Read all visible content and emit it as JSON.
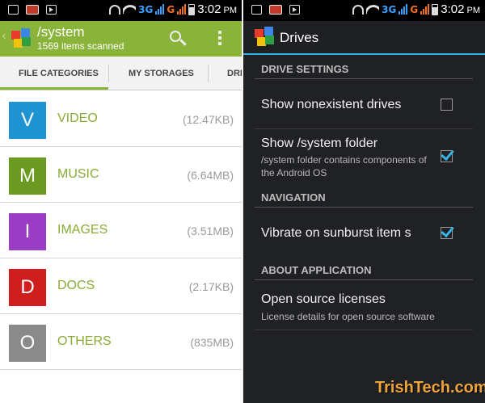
{
  "status_bar": {
    "time": "3:02",
    "period": "PM",
    "network_3g": "3G",
    "network_g": "G"
  },
  "left_screen": {
    "title": "/system",
    "subtitle": "1569 items scanned",
    "accent_color": "#8ab33a",
    "tabs": [
      {
        "label": "FILE CATEGORIES",
        "active": true
      },
      {
        "label": "MY STORAGES",
        "active": false
      },
      {
        "label": "DRI",
        "active": false
      }
    ],
    "categories": [
      {
        "letter": "V",
        "name": "VIDEO",
        "size": "(12.47KB)",
        "color": "#1e94d2"
      },
      {
        "letter": "M",
        "name": "MUSIC",
        "size": "(6.64MB)",
        "color": "#6a9a1f"
      },
      {
        "letter": "I",
        "name": "IMAGES",
        "size": "(3.51MB)",
        "color": "#9b3cc4"
      },
      {
        "letter": "D",
        "name": "DOCS",
        "size": "(2.17KB)",
        "color": "#d01e1e"
      },
      {
        "letter": "O",
        "name": "OTHERS",
        "size": "(835MB)",
        "color": "#8a8a8a"
      }
    ]
  },
  "right_screen": {
    "title": "Drives",
    "accent_color": "#33b5e5",
    "sections": {
      "drive_settings": "DRIVE SETTINGS",
      "navigation": "NAVIGATION",
      "about": "ABOUT APPLICATION"
    },
    "prefs": {
      "nonexistent": {
        "title": "Show nonexistent drives",
        "checked": false
      },
      "system_folder": {
        "title": "Show /system folder",
        "summary": "/system folder contains components of the Android OS",
        "checked": true
      },
      "vibrate": {
        "title": "Vibrate on sunburst item s",
        "checked": true
      },
      "licenses": {
        "title": "Open source licenses",
        "summary": "License details for open source software"
      }
    }
  },
  "watermark": "TrishTech.com"
}
